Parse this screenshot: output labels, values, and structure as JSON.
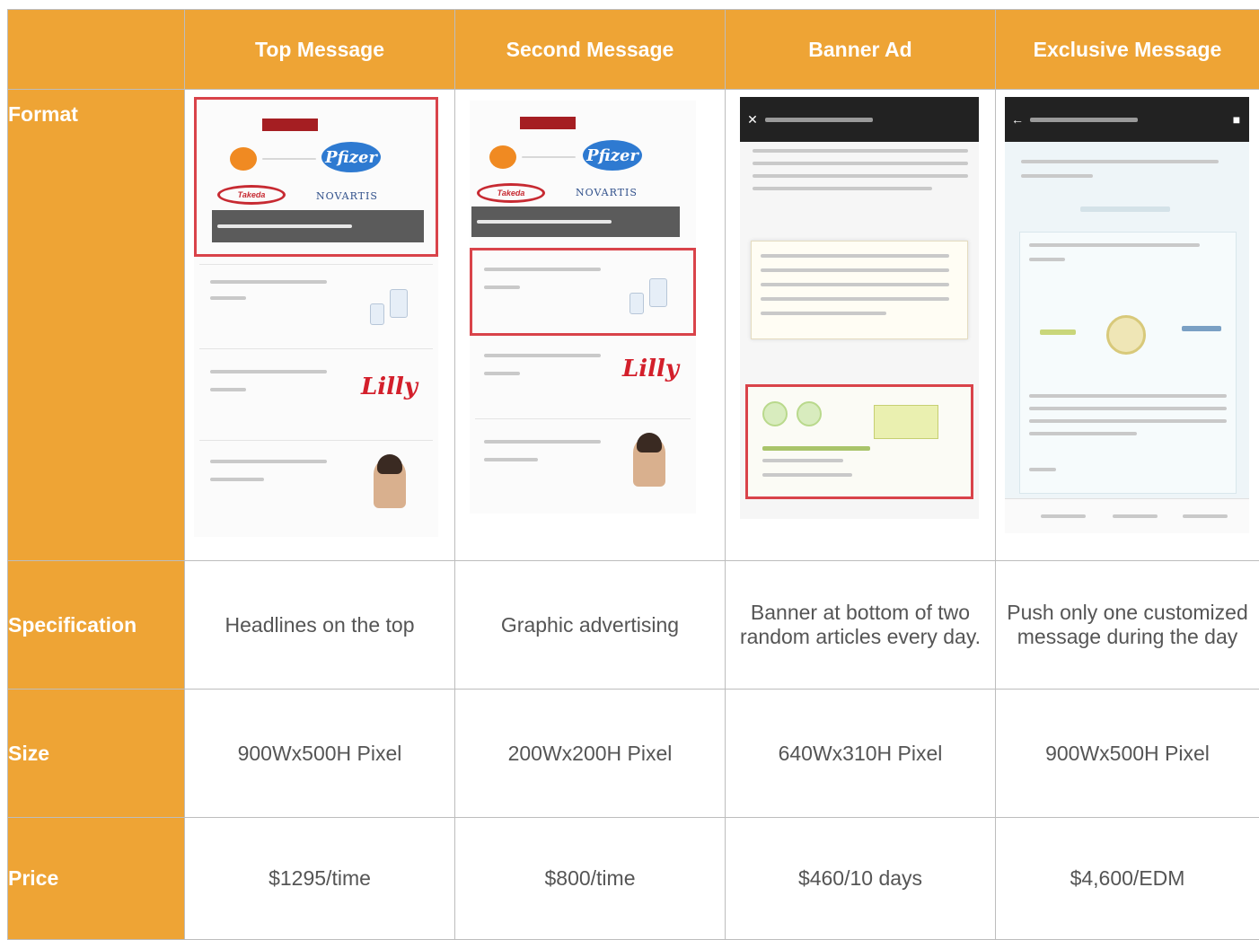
{
  "columns": [
    "",
    "Top Message",
    "Second Message",
    "Banner Ad",
    "Exclusive Message"
  ],
  "rows": {
    "format": {
      "label": "Format"
    },
    "specification": {
      "label": "Specification",
      "values": [
        "Headlines on the top",
        "Graphic advertising",
        "Banner at bottom of two random articles every day.",
        "Push only one customized message during the day"
      ]
    },
    "size": {
      "label": "Size",
      "values": [
        "900Wx500H Pixel",
        "200Wx200H Pixel",
        "640Wx310H Pixel",
        "900Wx500H Pixel"
      ]
    },
    "price": {
      "label": "Price",
      "values": [
        "$1295/time",
        "$800/time",
        "$460/10 days",
        "$4,600/EDM"
      ]
    }
  },
  "mockups": {
    "pfizer_text": "Pfizer",
    "takeda_text": "Takeda",
    "novartis_text": "NOVARTIS",
    "lilly_text": "Lilly"
  },
  "colors": {
    "header_bg": "#eea435",
    "header_text": "#ffffff",
    "value_text": "#555555",
    "grid_border": "#bdbdbd",
    "highlight_frame": "#d9434a"
  }
}
